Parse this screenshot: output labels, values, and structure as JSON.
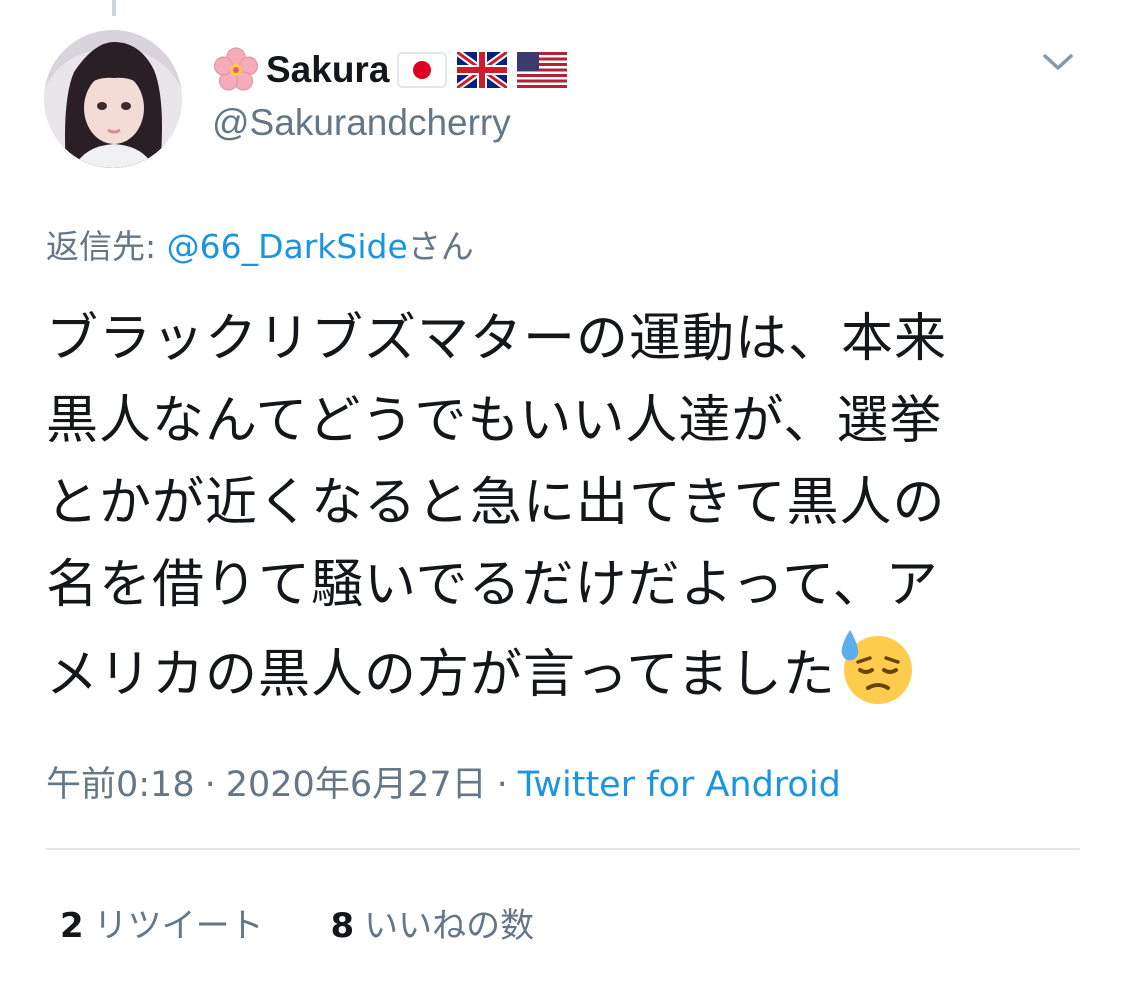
{
  "tweet": {
    "author": {
      "name": "Sakura",
      "handle": "@Sakurandcherry",
      "name_emoji": [
        "cherry-blossom-icon",
        "japan-flag-icon",
        "uk-flag-icon",
        "us-flag-icon"
      ]
    },
    "reply_to": {
      "prefix": "返信先: ",
      "mention": "@66_DarkSide",
      "suffix": "さん"
    },
    "text_lines": [
      "ブラックリブズマターの運動は、本来",
      "黒人なんてどうでもいい人達が、選挙",
      "とかが近くなると急に出てきて黒人の",
      "名を借りて騒いでるだけだよって、ア",
      "メリカの黒人の方が言ってました"
    ],
    "trailing_emoji": "downcast-face-with-sweat-icon",
    "meta": {
      "time": "午前0:18",
      "separator": "·",
      "date": "2020年6月27日",
      "source": "Twitter for Android"
    },
    "stats": {
      "retweets_count": "2",
      "retweets_label": "リツイート",
      "likes_count": "8",
      "likes_label": "いいねの数"
    }
  },
  "colors": {
    "text": "#14171a",
    "secondary": "#657786",
    "link": "#1b95e0",
    "divider": "#e1e8ed"
  }
}
